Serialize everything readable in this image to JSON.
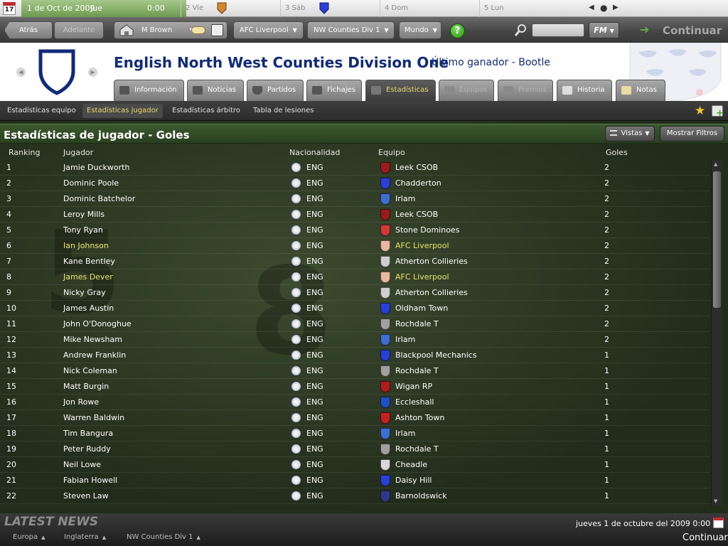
{
  "topbar": {
    "calendar_day": "17",
    "current_date": "1 de Oct de 2009",
    "current_weekday": "Jue",
    "current_time": "0:00",
    "days": [
      "2 Vie",
      "3 Sáb",
      "4 Dom",
      "5 Lun"
    ]
  },
  "toolbar": {
    "back": "Atrás",
    "forward": "Adelante",
    "manager": "M Brown",
    "club": "AFC Liverpool",
    "division": "NW Counties Div 1",
    "world": "Mundo",
    "help": "?",
    "fm": "FM",
    "continue": "Continuar"
  },
  "header": {
    "title": "English North West Counties Division One",
    "last_winner": "Último ganador - Bootle",
    "tabs": [
      {
        "label": "Información",
        "state": "normal"
      },
      {
        "label": "Noticias",
        "state": "normal"
      },
      {
        "label": "Partidos",
        "state": "normal"
      },
      {
        "label": "Fichajes",
        "state": "normal"
      },
      {
        "label": "Estadísticas",
        "state": "active"
      },
      {
        "label": "Equipos",
        "state": "disabled"
      },
      {
        "label": "Premios",
        "state": "disabled"
      },
      {
        "label": "Historia",
        "state": "normal"
      },
      {
        "label": "Notas",
        "state": "normal"
      }
    ]
  },
  "subtabs": [
    "Estadísticas equipo",
    "Estadísticas jugador",
    "Estadísticas árbitro",
    "Tabla de lesiones"
  ],
  "panel": {
    "title": "Estadísticas de jugador - Goles",
    "views_button": "Vistas",
    "filters_button": "Mostrar Filtros",
    "columns": [
      "Ranking",
      "Jugador",
      "Nacionalidad",
      "Equipo",
      "Goles"
    ]
  },
  "rows": [
    {
      "rank": "1",
      "player": "Jamie Duckworth",
      "nat": "ENG",
      "club": "Leek CSOB",
      "goals": "2",
      "crest": "#9a1b1b",
      "hl": false
    },
    {
      "rank": "2",
      "player": "Dominic Poole",
      "nat": "ENG",
      "club": "Chadderton",
      "goals": "2",
      "crest": "#2a3fd6",
      "hl": false
    },
    {
      "rank": "3",
      "player": "Dominic Batchelor",
      "nat": "ENG",
      "club": "Irlam",
      "goals": "2",
      "crest": "#3c6fd0",
      "hl": false
    },
    {
      "rank": "4",
      "player": "Leroy Mills",
      "nat": "ENG",
      "club": "Leek CSOB",
      "goals": "2",
      "crest": "#9a1b1b",
      "hl": false
    },
    {
      "rank": "5",
      "player": "Tony Ryan",
      "nat": "ENG",
      "club": "Stone Dominoes",
      "goals": "2",
      "crest": "#d23a3a",
      "hl": false
    },
    {
      "rank": "6",
      "player": "Ian Johnson",
      "nat": "ENG",
      "club": "AFC Liverpool",
      "goals": "2",
      "crest": "#e9b8a0",
      "hl": true
    },
    {
      "rank": "7",
      "player": "Kane Bentley",
      "nat": "ENG",
      "club": "Atherton Collieries",
      "goals": "2",
      "crest": "#cfcfcf",
      "hl": false
    },
    {
      "rank": "8",
      "player": "James Dever",
      "nat": "ENG",
      "club": "AFC Liverpool",
      "goals": "2",
      "crest": "#e9b8a0",
      "hl": true
    },
    {
      "rank": "9",
      "player": "Nicky Gray",
      "nat": "ENG",
      "club": "Atherton Collieries",
      "goals": "2",
      "crest": "#cfcfcf",
      "hl": false
    },
    {
      "rank": "10",
      "player": "James Austin",
      "nat": "ENG",
      "club": "Oldham Town",
      "goals": "2",
      "crest": "#2a3fd6",
      "hl": false
    },
    {
      "rank": "11",
      "player": "John O'Donoghue",
      "nat": "ENG",
      "club": "Rochdale T",
      "goals": "2",
      "crest": "#a0a0a0",
      "hl": false
    },
    {
      "rank": "12",
      "player": "Mike Newsham",
      "nat": "ENG",
      "club": "Irlam",
      "goals": "2",
      "crest": "#3c6fd0",
      "hl": false
    },
    {
      "rank": "13",
      "player": "Andrew Franklin",
      "nat": "ENG",
      "club": "Blackpool Mechanics",
      "goals": "1",
      "crest": "#2a3fd6",
      "hl": false
    },
    {
      "rank": "14",
      "player": "Nick Coleman",
      "nat": "ENG",
      "club": "Rochdale T",
      "goals": "1",
      "crest": "#a0a0a0",
      "hl": false
    },
    {
      "rank": "15",
      "player": "Matt Burgin",
      "nat": "ENG",
      "club": "Wigan RP",
      "goals": "1",
      "crest": "#b01c1c",
      "hl": false
    },
    {
      "rank": "16",
      "player": "Jon Rowe",
      "nat": "ENG",
      "club": "Eccleshall",
      "goals": "1",
      "crest": "#1f4fc4",
      "hl": false
    },
    {
      "rank": "17",
      "player": "Warren Baldwin",
      "nat": "ENG",
      "club": "Ashton Town",
      "goals": "1",
      "crest": "#c82020",
      "hl": false
    },
    {
      "rank": "18",
      "player": "Tim Bangura",
      "nat": "ENG",
      "club": "Irlam",
      "goals": "1",
      "crest": "#3c6fd0",
      "hl": false
    },
    {
      "rank": "19",
      "player": "Peter Ruddy",
      "nat": "ENG",
      "club": "Rochdale T",
      "goals": "1",
      "crest": "#a0a0a0",
      "hl": false
    },
    {
      "rank": "20",
      "player": "Neil Lowe",
      "nat": "ENG",
      "club": "Cheadle",
      "goals": "1",
      "crest": "#d8d8d8",
      "hl": false
    },
    {
      "rank": "21",
      "player": "Fabian Howell",
      "nat": "ENG",
      "club": "Daisy Hill",
      "goals": "1",
      "crest": "#2a3fd6",
      "hl": false
    },
    {
      "rank": "22",
      "player": "Steven Law",
      "nat": "ENG",
      "club": "Barnoldswick",
      "goals": "1",
      "crest": "#2d3a8a",
      "hl": false
    }
  ],
  "footer": {
    "latest_news": "LATEST NEWS",
    "crumbs": [
      "Europa",
      "Inglaterra",
      "NW Counties Div 1"
    ],
    "date": "jueves 1 de octubre del 2009 0:00",
    "continue": "Continuar"
  }
}
